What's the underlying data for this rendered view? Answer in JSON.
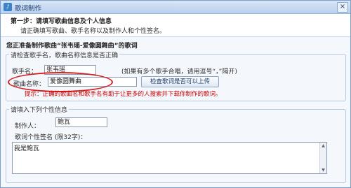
{
  "window": {
    "title": "歌词制作",
    "close": "×",
    "app_icon": "lyrics-app-icon"
  },
  "step": {
    "heading": "第一步：请填写歌曲信息及个人信息",
    "desc": "请正确填写歌曲、歌手名称以及制作人和个性签名。"
  },
  "intro": "您正准备制作歌曲“张韦瑶-爱像圆舞曲”的歌词",
  "song_section": {
    "legend": "请检查歌手名，歌曲名称信息是否正确",
    "singer_label": "歌手名：",
    "singer_value": "张韦瑶",
    "singer_note": "(如果有多个歌手合唱，请用逗号“，”隔开)",
    "song_label": "歌曲名称：",
    "song_value": "爱像圆舞曲",
    "check_button": "检查歌词是否可以上传",
    "hint": "提示：正确的歌曲名和歌手名有助于让更多的人搜索并下载你制作的歌词。"
  },
  "personal_section": {
    "legend": "请填入下列个性信息",
    "producer_label": "制作人：",
    "producer_value": "鲍瓦",
    "signature_label": "歌词个性签名 (限32字)：",
    "signature_value": "我是鲍瓦"
  }
}
